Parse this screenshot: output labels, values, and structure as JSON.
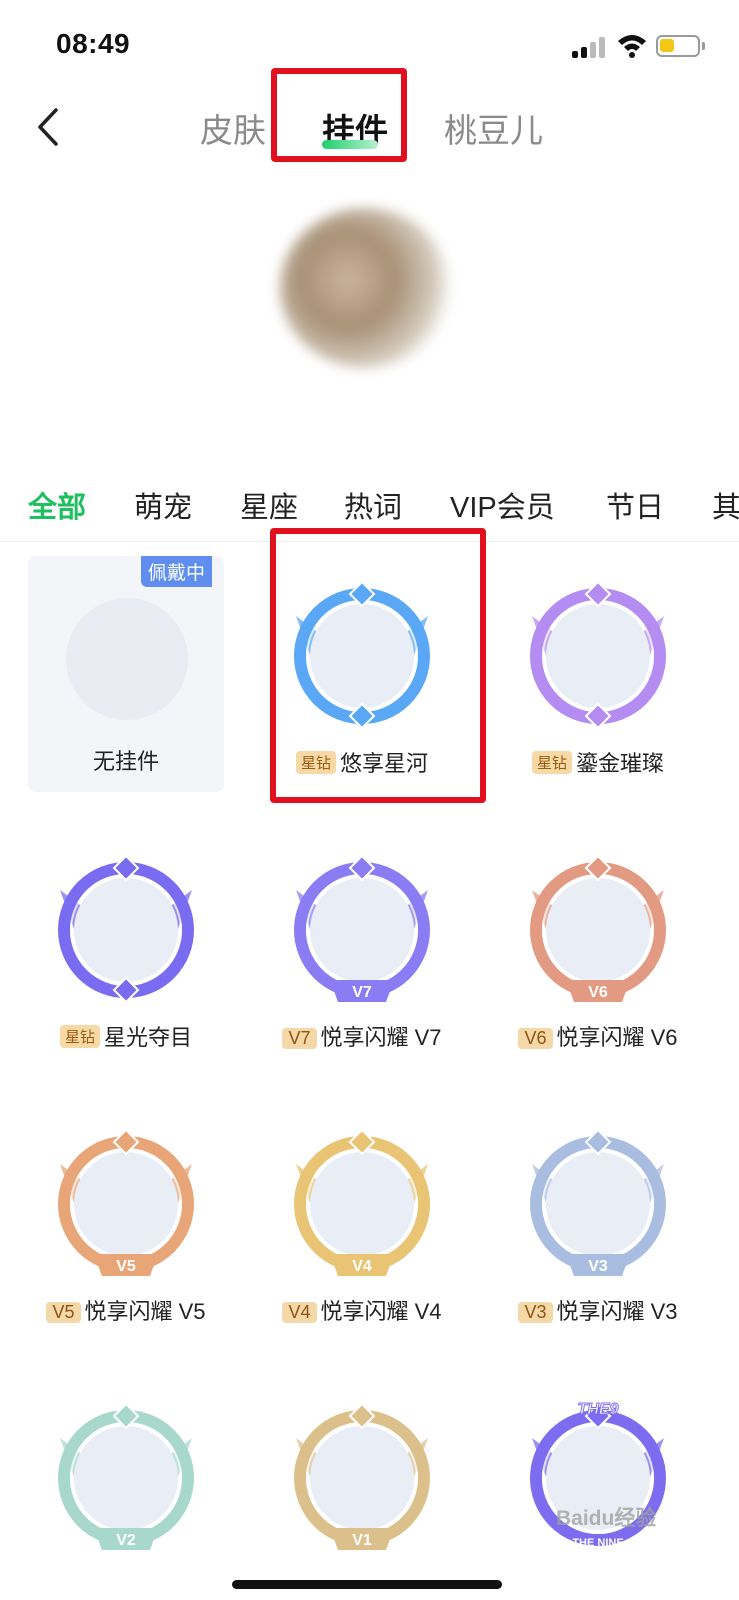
{
  "status_bar": {
    "time": "08:49",
    "battery_color": "#f3c718"
  },
  "header": {
    "back_icon": "chevron-left-icon",
    "tabs": [
      {
        "label": "皮肤",
        "active": false
      },
      {
        "label": "挂件",
        "active": true
      },
      {
        "label": "桃豆儿",
        "active": false
      }
    ],
    "active_color": "#1dbf5e",
    "highlight_color": "#e0101e"
  },
  "categories": [
    {
      "label": "全部",
      "active": true
    },
    {
      "label": "萌宠"
    },
    {
      "label": "星座"
    },
    {
      "label": "热词"
    },
    {
      "label": "VIP会员"
    },
    {
      "label": "节日"
    },
    {
      "label": "其"
    }
  ],
  "pendants": {
    "none": {
      "label": "无挂件",
      "status": "佩戴中"
    },
    "items": [
      {
        "badge": "星钻",
        "name": "悠享星河",
        "color": "#5aa8f5"
      },
      {
        "badge": "星钻",
        "name": "鎏金璀璨",
        "color": "#b58cf2"
      },
      {
        "badge": "星钻",
        "name": "星光夺目",
        "color": "#7a6cf0"
      },
      {
        "badge": "V7",
        "name": "悦享闪耀 V7",
        "frame_text": "V7",
        "color": "#8a7cf3"
      },
      {
        "badge": "V6",
        "name": "悦享闪耀 V6",
        "frame_text": "V6",
        "color": "#e39a82"
      },
      {
        "badge": "V5",
        "name": "悦享闪耀 V5",
        "frame_text": "V5",
        "color": "#e8a678"
      },
      {
        "badge": "V4",
        "name": "悦享闪耀 V4",
        "frame_text": "V4",
        "color": "#e8c474"
      },
      {
        "badge": "V3",
        "name": "悦享闪耀 V3",
        "frame_text": "V3",
        "color": "#a9bde0"
      },
      {
        "frame_text": "V2",
        "color": "#a8d8cc"
      },
      {
        "frame_text": "V1",
        "color": "#dcc08c"
      },
      {
        "frame_text": "THE9",
        "frame_subtext": "THE NINE",
        "color": "#7d6cf0"
      }
    ]
  },
  "watermark": "Baidu经验"
}
